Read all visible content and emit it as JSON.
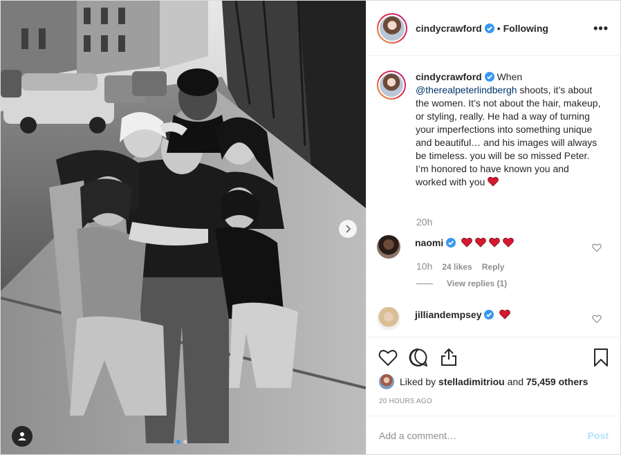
{
  "post": {
    "author": {
      "username": "cindycrawford",
      "follow_status": "Following",
      "separator": "•"
    },
    "more_options": "•••",
    "caption": {
      "username": "cindycrawford",
      "text_before": "When",
      "mention": "@therealpeterlindbergh",
      "text_after": "shoots, it’s about the women. It’s not about the hair, makeup, or styling, really. He had a way of turning your imperfections into something unique and beautiful… and his images will always be timeless. you will be so missed Peter. I’m honored to have known you and worked with you",
      "time": "20h"
    },
    "comments": [
      {
        "username": "naomi",
        "hearts": 4,
        "time": "10h",
        "likes": "24 likes",
        "reply": "Reply",
        "view_replies": "View replies (1)"
      },
      {
        "username": "jilliandempsey",
        "hearts": 1
      }
    ],
    "likes": {
      "prefix": "Liked by",
      "user": "stelladimitriou",
      "middle": "and",
      "others": "75,459 others"
    },
    "timestamp": "20 HOURS AGO",
    "add_comment": {
      "placeholder": "Add a comment…",
      "post_label": "Post"
    },
    "carousel": {
      "slides": 2,
      "active": 0
    },
    "colors": {
      "verified": "#3897f0",
      "heart": "#d7192f",
      "link": "#003569",
      "post_disabled": "#b2dffc"
    }
  }
}
